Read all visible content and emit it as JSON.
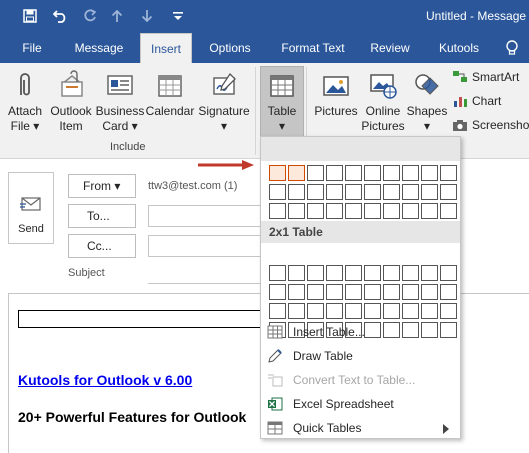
{
  "window": {
    "title": "Untitled - Message"
  },
  "quick_access": {
    "save_icon": "save-icon",
    "undo_icon": "undo-icon",
    "redo_icon": "redo-icon",
    "up_icon": "up-arrow-icon",
    "down_icon": "down-arrow-icon",
    "customize_icon": "customize-qat-icon"
  },
  "tabs": [
    {
      "label": "File"
    },
    {
      "label": "Message"
    },
    {
      "label": "Insert"
    },
    {
      "label": "Options"
    },
    {
      "label": "Format Text"
    },
    {
      "label": "Review"
    },
    {
      "label": "Kutools"
    }
  ],
  "ribbon": {
    "attach_file": {
      "line1": "Attach",
      "line2": "File ▾"
    },
    "outlook_item": {
      "line1": "Outlook",
      "line2": "Item"
    },
    "business_card": {
      "line1": "Business",
      "line2": "Card ▾"
    },
    "calendar": {
      "line1": "Calendar",
      "line2": ""
    },
    "signature": {
      "line1": "Signature",
      "line2": "▾"
    },
    "include_label": "Include",
    "table": {
      "line1": "Table",
      "line2": "▾"
    },
    "pictures": {
      "line1": "Pictures",
      "line2": ""
    },
    "online_pictures": {
      "line1": "Online",
      "line2": "Pictures"
    },
    "shapes": {
      "line1": "Shapes",
      "line2": "▾"
    },
    "smartart": "SmartArt",
    "chart": "Chart",
    "screenshot": "Screenshot"
  },
  "compose": {
    "send_label": "Send",
    "from_label": "From ▾",
    "from_value": "ttw3@test.com (1)",
    "to_label": "To...",
    "cc_label": "Cc...",
    "subject_label": "Subject",
    "body_link": "Kutools for Outlook v 6.00",
    "body_heading": "20+ Powerful Features for Outlook"
  },
  "table_dropdown": {
    "header": "2x1 Table",
    "grid_cols": 10,
    "grid_rows": 8,
    "selected_cols": 2,
    "selected_rows": 1,
    "items": [
      {
        "label": "Insert Table...",
        "disabled": false
      },
      {
        "label": "Draw Table",
        "disabled": false
      },
      {
        "label": "Convert Text to Table...",
        "disabled": true
      },
      {
        "label": "Excel Spreadsheet",
        "disabled": false
      },
      {
        "label": "Quick Tables",
        "disabled": false
      }
    ]
  },
  "colors": {
    "accent": "#2b579a",
    "selection": "#d04a02",
    "arrow": "#c0392b"
  }
}
